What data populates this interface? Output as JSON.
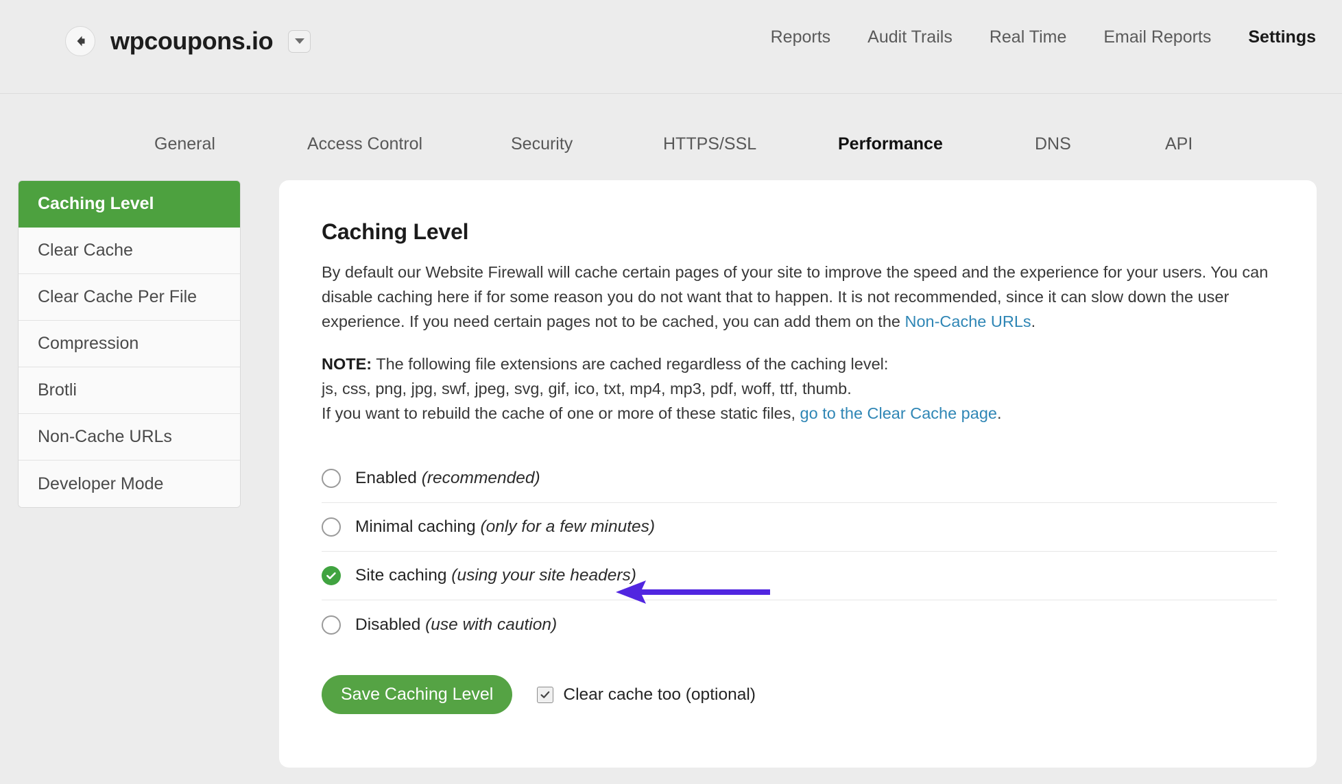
{
  "header": {
    "site_name": "wpcoupons.io",
    "back_icon": "arrow-left-icon",
    "dropdown_icon": "chevron-down-icon",
    "nav": [
      {
        "label": "Reports",
        "active": false
      },
      {
        "label": "Audit Trails",
        "active": false
      },
      {
        "label": "Real Time",
        "active": false
      },
      {
        "label": "Email Reports",
        "active": false
      },
      {
        "label": "Settings",
        "active": true
      }
    ]
  },
  "tabs": [
    {
      "label": "General",
      "active": false
    },
    {
      "label": "Access Control",
      "active": false
    },
    {
      "label": "Security",
      "active": false
    },
    {
      "label": "HTTPS/SSL",
      "active": false
    },
    {
      "label": "Performance",
      "active": true
    },
    {
      "label": "DNS",
      "active": false
    },
    {
      "label": "API",
      "active": false
    }
  ],
  "sidebar": {
    "items": [
      {
        "label": "Caching Level",
        "active": true
      },
      {
        "label": "Clear Cache",
        "active": false
      },
      {
        "label": "Clear Cache Per File",
        "active": false
      },
      {
        "label": "Compression",
        "active": false
      },
      {
        "label": "Brotli",
        "active": false
      },
      {
        "label": "Non-Cache URLs",
        "active": false
      },
      {
        "label": "Developer Mode",
        "active": false
      }
    ]
  },
  "main": {
    "title": "Caching Level",
    "paragraph_part1": "By default our Website Firewall will cache certain pages of your site to improve the speed and the experience for your users. You can disable caching here if for some reason you do not want that to happen. It is not recommended, since it can slow down the user experience. If you need certain pages not to be cached, you can add them on the ",
    "non_cache_link": "Non-Cache URLs",
    "paragraph_part2": ".",
    "note_label": "NOTE:",
    "note_text": " The following file extensions are cached regardless of the caching level:",
    "extensions_line": "js, css, png, jpg, swf, jpeg, svg, gif, ico, txt, mp4, mp3, pdf, woff, ttf, thumb.",
    "rebuild_text": "If you want to rebuild the cache of one or more of these static files, ",
    "clear_cache_link": "go to the Clear Cache page",
    "rebuild_text_end": ".",
    "options": [
      {
        "label": "Enabled ",
        "hint": "(recommended)",
        "selected": false
      },
      {
        "label": "Minimal caching ",
        "hint": "(only for a few minutes)",
        "selected": false
      },
      {
        "label": "Site caching ",
        "hint": "(using your site headers)",
        "selected": true
      },
      {
        "label": "Disabled ",
        "hint": "(use with caution)",
        "selected": false
      }
    ],
    "save_button": "Save Caching Level",
    "clear_cache_checkbox_label": "Clear cache too (optional)",
    "clear_cache_checked": true
  },
  "annotation": {
    "type": "arrow-left-annotation",
    "color": "#5126e0",
    "points_to": "Site caching (using your site headers)"
  },
  "colors": {
    "page_background": "#ececec",
    "card_background": "#ffffff",
    "accent_green": "#4da13f",
    "button_green": "#55a344",
    "link_blue": "#2f86b5",
    "annotation_purple": "#5126e0"
  }
}
